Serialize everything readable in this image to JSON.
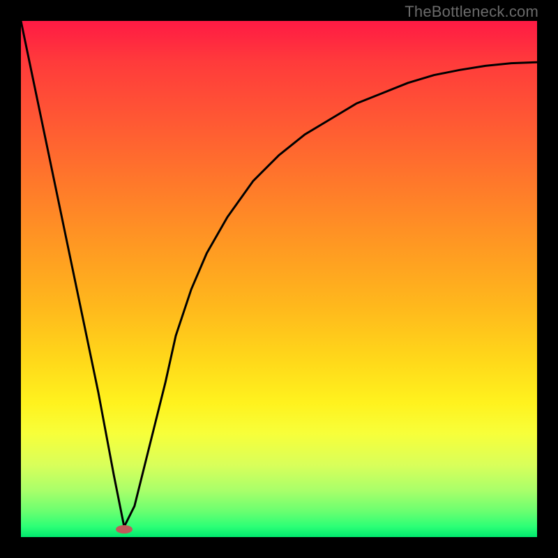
{
  "watermark": {
    "text": "TheBottleneck.com"
  },
  "marker": {
    "title": "marker"
  },
  "chart_data": {
    "type": "line",
    "title": "",
    "xlabel": "",
    "ylabel": "",
    "xlim": [
      0,
      100
    ],
    "ylim": [
      0,
      100
    ],
    "series": [
      {
        "name": "curve",
        "x": [
          0,
          5,
          10,
          15,
          18,
          20,
          22,
          25,
          28,
          30,
          33,
          36,
          40,
          45,
          50,
          55,
          60,
          65,
          70,
          75,
          80,
          85,
          90,
          95,
          100
        ],
        "y": [
          100,
          76,
          52,
          28,
          12,
          2,
          6,
          18,
          30,
          39,
          48,
          55,
          62,
          69,
          74,
          78,
          81,
          84,
          86,
          88,
          89.5,
          90.5,
          91.3,
          91.8,
          92
        ]
      }
    ],
    "marker": {
      "x": 20,
      "y": 1.5,
      "color": "#c05a5a",
      "rx": 12,
      "ry": 6
    },
    "grid": false,
    "legend": false
  }
}
